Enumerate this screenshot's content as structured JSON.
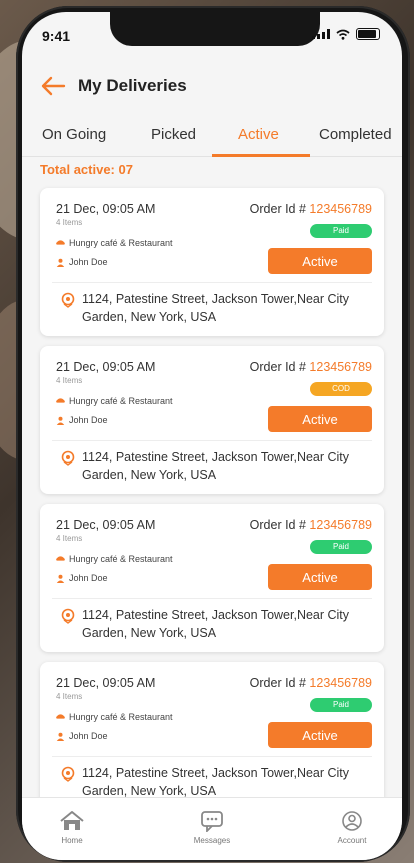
{
  "status": {
    "time": "9:41"
  },
  "header": {
    "title": "My Deliveries"
  },
  "tabs": [
    {
      "label": "On Going"
    },
    {
      "label": "Picked"
    },
    {
      "label": "Active"
    },
    {
      "label": "Completed"
    }
  ],
  "summary": {
    "total_label": "Total active: 07"
  },
  "cards": [
    {
      "date": "21 Dec, 09:05 AM",
      "items": "4 Items",
      "restaurant": "Hungry café & Restaurant",
      "customer": "John Doe",
      "order_prefix": "Order Id #",
      "order_id": "123456789",
      "payment": "Paid",
      "action": "Active",
      "address": "1124, Patestine Street, Jackson Tower,Near City Garden, New York, USA"
    },
    {
      "date": "21 Dec, 09:05 AM",
      "items": "4 Items",
      "restaurant": "Hungry café & Restaurant",
      "customer": "John Doe",
      "order_prefix": "Order Id #",
      "order_id": "123456789",
      "payment": "COD",
      "action": "Active",
      "address": "1124, Patestine Street, Jackson Tower,Near City Garden, New York, USA"
    },
    {
      "date": "21 Dec, 09:05 AM",
      "items": "4 Items",
      "restaurant": "Hungry café & Restaurant",
      "customer": "John Doe",
      "order_prefix": "Order Id #",
      "order_id": "123456789",
      "payment": "Paid",
      "action": "Active",
      "address": "1124, Patestine Street, Jackson Tower,Near City Garden, New York, USA"
    },
    {
      "date": "21 Dec, 09:05 AM",
      "items": "4 Items",
      "restaurant": "Hungry café & Restaurant",
      "customer": "John Doe",
      "order_prefix": "Order Id #",
      "order_id": "123456789",
      "payment": "Paid",
      "action": "Active",
      "address": "1124, Patestine Street, Jackson Tower,Near City Garden, New York, USA"
    }
  ],
  "bottom_nav": [
    {
      "label": "Home",
      "icon": "home-icon"
    },
    {
      "label": "Messages",
      "icon": "chat-icon"
    },
    {
      "label": "Account",
      "icon": "user-icon"
    }
  ],
  "colors": {
    "accent": "#f47b2a",
    "paid": "#2ecc71",
    "cod": "#f5a623"
  }
}
